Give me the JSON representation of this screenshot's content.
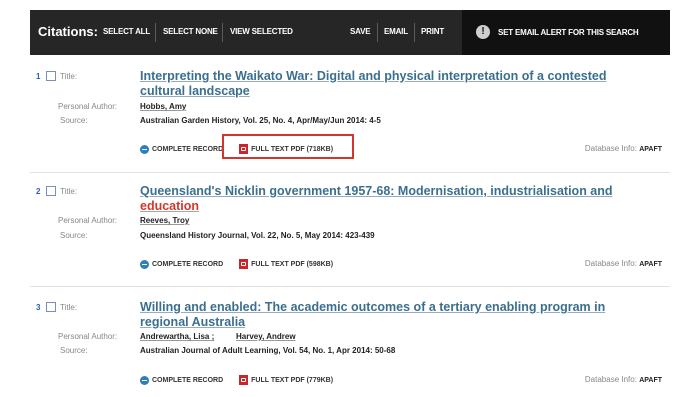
{
  "citations_bar": {
    "label": "Citations:",
    "actions": [
      "SELECT ALL",
      "SELECT NONE",
      "VIEW SELECTED",
      "SAVE",
      "EMAIL",
      "PRINT"
    ],
    "alert_label": "SET EMAIL ALERT FOR THIS SEARCH"
  },
  "field_labels": {
    "title": "Title:",
    "author": "Personal Author:",
    "source": "Source:",
    "database": "Database Info:"
  },
  "link_labels": {
    "complete_record": "COMPLETE RECORD"
  },
  "records": [
    {
      "number": "1",
      "title": "Interpreting the Waikato War: Digital and physical interpretation of a contested cultural landscape",
      "author": "Hobbs, Amy",
      "source": "Australian Garden History, Vol. 25, No. 4, Apr/May/Jun 2014: 4-5",
      "pdf_label": "FULL TEXT PDF (718KB)",
      "database": "APAFT"
    },
    {
      "number": "2",
      "title": "Queensland's Nicklin government 1957-68: Modernisation, industrialisation and",
      "title_highlight": "education",
      "author": "Reeves, Troy",
      "source": "Queensland History Journal, Vol. 22, No. 5, May 2014: 423-439",
      "pdf_label": "FULL TEXT PDF (598KB)",
      "database": "APAFT"
    },
    {
      "number": "3",
      "title": "Willing and enabled: The academic outcomes of a tertiary enabling program in regional Australia",
      "author": "Andrewartha, Lisa ;",
      "author2": "Harvey, Andrew",
      "source": "Australian Journal of Adult Learning, Vol. 54, No. 1, Apr 2014: 50-68",
      "pdf_label": "FULL TEXT PDF (779KB)",
      "database": "APAFT"
    }
  ],
  "colors": {
    "toolbar_bg": "#262626",
    "alert_bg": "#111111",
    "title_link": "#3b6f8f",
    "highlight": "#d4372a",
    "annotation_box": "#d4342c"
  }
}
